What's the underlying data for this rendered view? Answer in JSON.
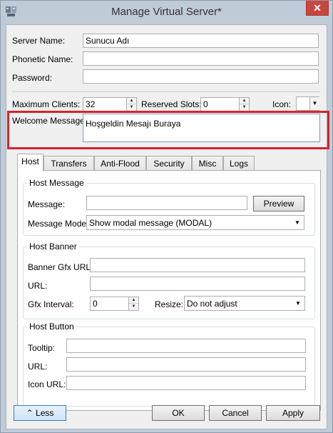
{
  "window": {
    "title": "Manage Virtual Server*",
    "close_glyph": "✕"
  },
  "fields": {
    "server_name_label": "Server Name:",
    "server_name_value": "Sunucu Adı",
    "phonetic_name_label": "Phonetic Name:",
    "phonetic_name_value": "",
    "password_label": "Password:",
    "password_value": "",
    "max_clients_label": "Maximum Clients:",
    "max_clients_value": "32",
    "reserved_slots_label": "Reserved Slots:",
    "reserved_slots_value": "0",
    "icon_label": "Icon:",
    "welcome_label": "Welcome Message:",
    "welcome_value": "Hoşgeldin Mesajı Buraya"
  },
  "tabs": [
    "Host",
    "Transfers",
    "Anti-Flood",
    "Security",
    "Misc",
    "Logs"
  ],
  "host": {
    "message_group": {
      "title": "Host Message",
      "message_label": "Message:",
      "message_value": "",
      "preview_button": "Preview",
      "mode_label": "Message Mode:",
      "mode_value": "Show modal message (MODAL)"
    },
    "banner_group": {
      "title": "Host Banner",
      "gfx_url_label": "Banner Gfx URL:",
      "gfx_url_value": "",
      "url_label": "URL:",
      "url_value": "",
      "interval_label": "Gfx Interval:",
      "interval_value": "0",
      "resize_label": "Resize:",
      "resize_value": "Do not adjust"
    },
    "button_group": {
      "title": "Host Button",
      "tooltip_label": "Tooltip:",
      "tooltip_value": "",
      "url_label": "URL:",
      "url_value": "",
      "icon_url_label": "Icon URL:",
      "icon_url_value": ""
    }
  },
  "buttons": {
    "less": "Less",
    "ok": "OK",
    "cancel": "Cancel",
    "apply": "Apply"
  },
  "highlight_color": "#d9232a",
  "icons": {
    "spin_up": "▲",
    "spin_down": "▼",
    "dropdown": "▼"
  }
}
